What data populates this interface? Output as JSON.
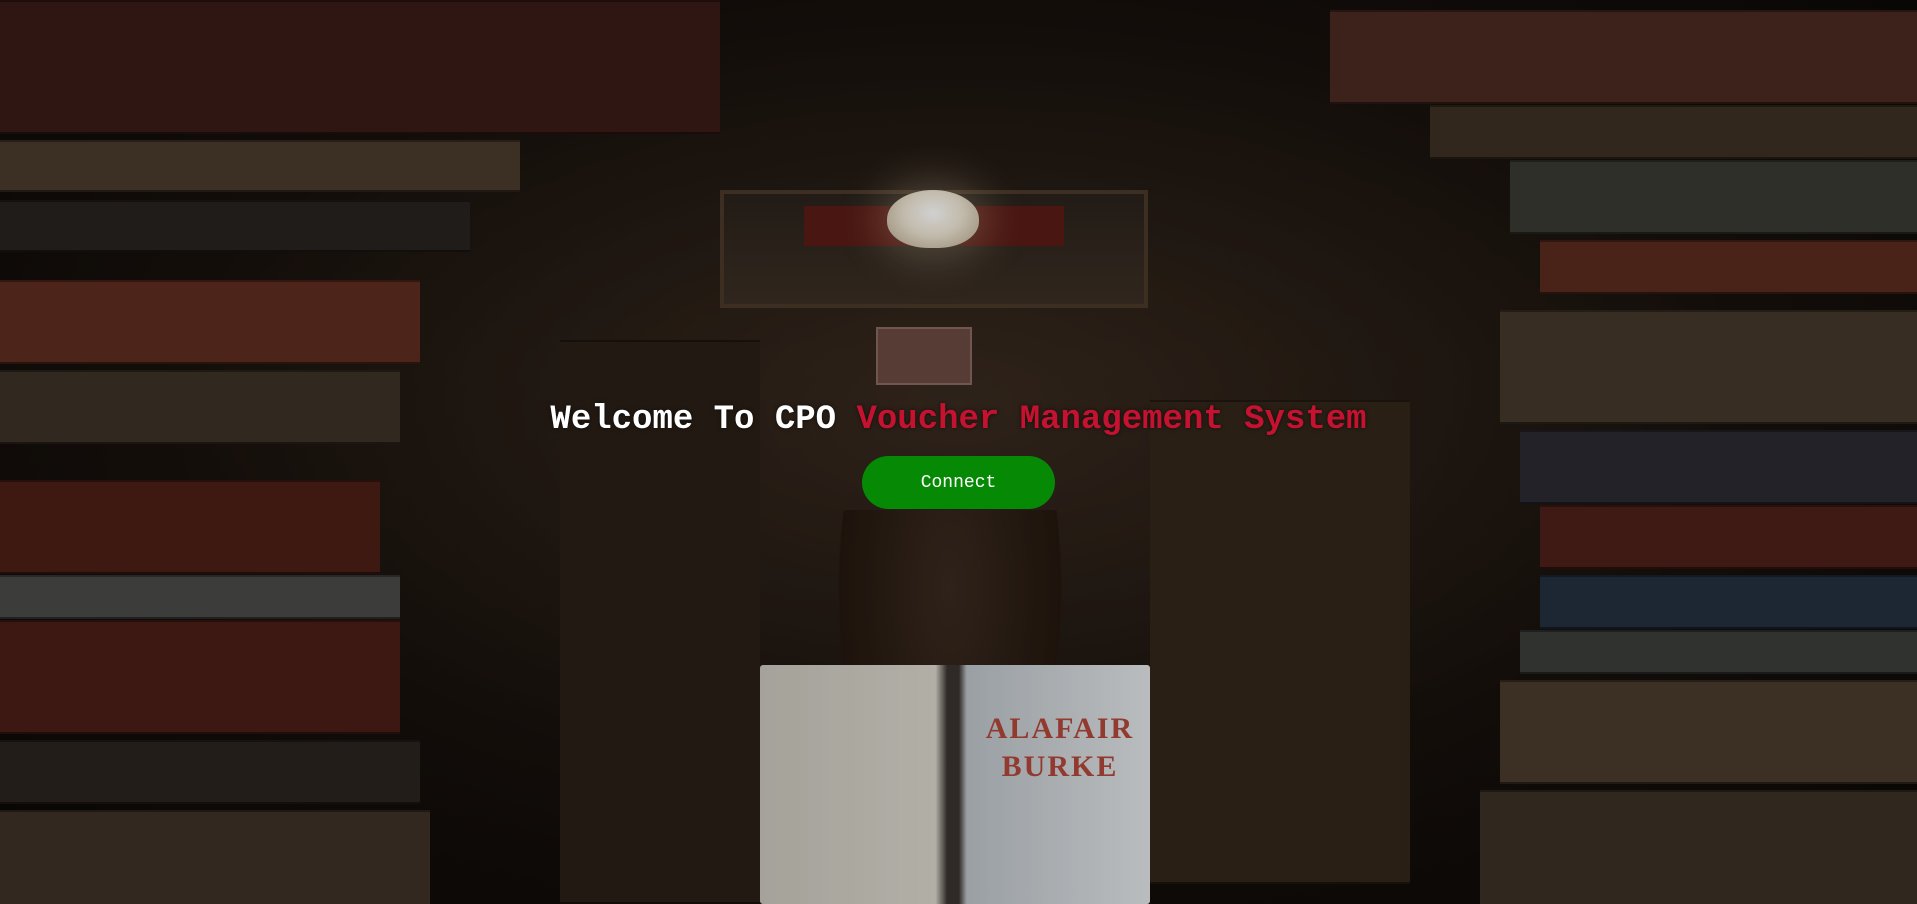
{
  "hero": {
    "welcome_prefix": "Welcome To CPO ",
    "welcome_highlight": "Voucher Management System",
    "connect_label": "Connect",
    "background": "library-bookstacks-photo",
    "colors": {
      "prefix_text": "#ffffff",
      "highlight_text": "#c41230",
      "button_bg": "#068a06",
      "button_text": "#ffffff"
    }
  }
}
